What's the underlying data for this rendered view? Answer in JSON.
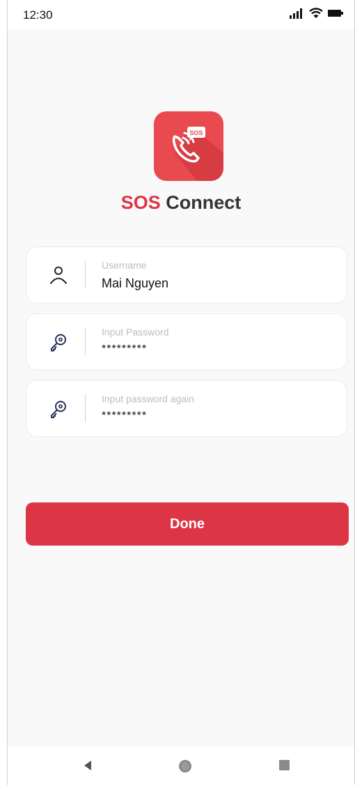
{
  "status_bar": {
    "time": "12:30"
  },
  "app": {
    "title_accent": "SOS",
    "title_rest": "Connect",
    "logo_badge": "SOS"
  },
  "form": {
    "username": {
      "label": "Username",
      "value": "Mai Nguyen"
    },
    "password": {
      "label": "Input Password",
      "value": "*********"
    },
    "password_again": {
      "label": "Input password again",
      "value": "*********"
    }
  },
  "done_button": {
    "label": "Done"
  },
  "colors": {
    "accent": "#dc3545",
    "logo": "#e84a4f",
    "background": "#f9f9f9"
  },
  "icons": [
    "signal-icon",
    "wifi-icon",
    "battery-icon",
    "user-icon",
    "key-icon",
    "back-icon",
    "home-icon",
    "recents-icon"
  ]
}
